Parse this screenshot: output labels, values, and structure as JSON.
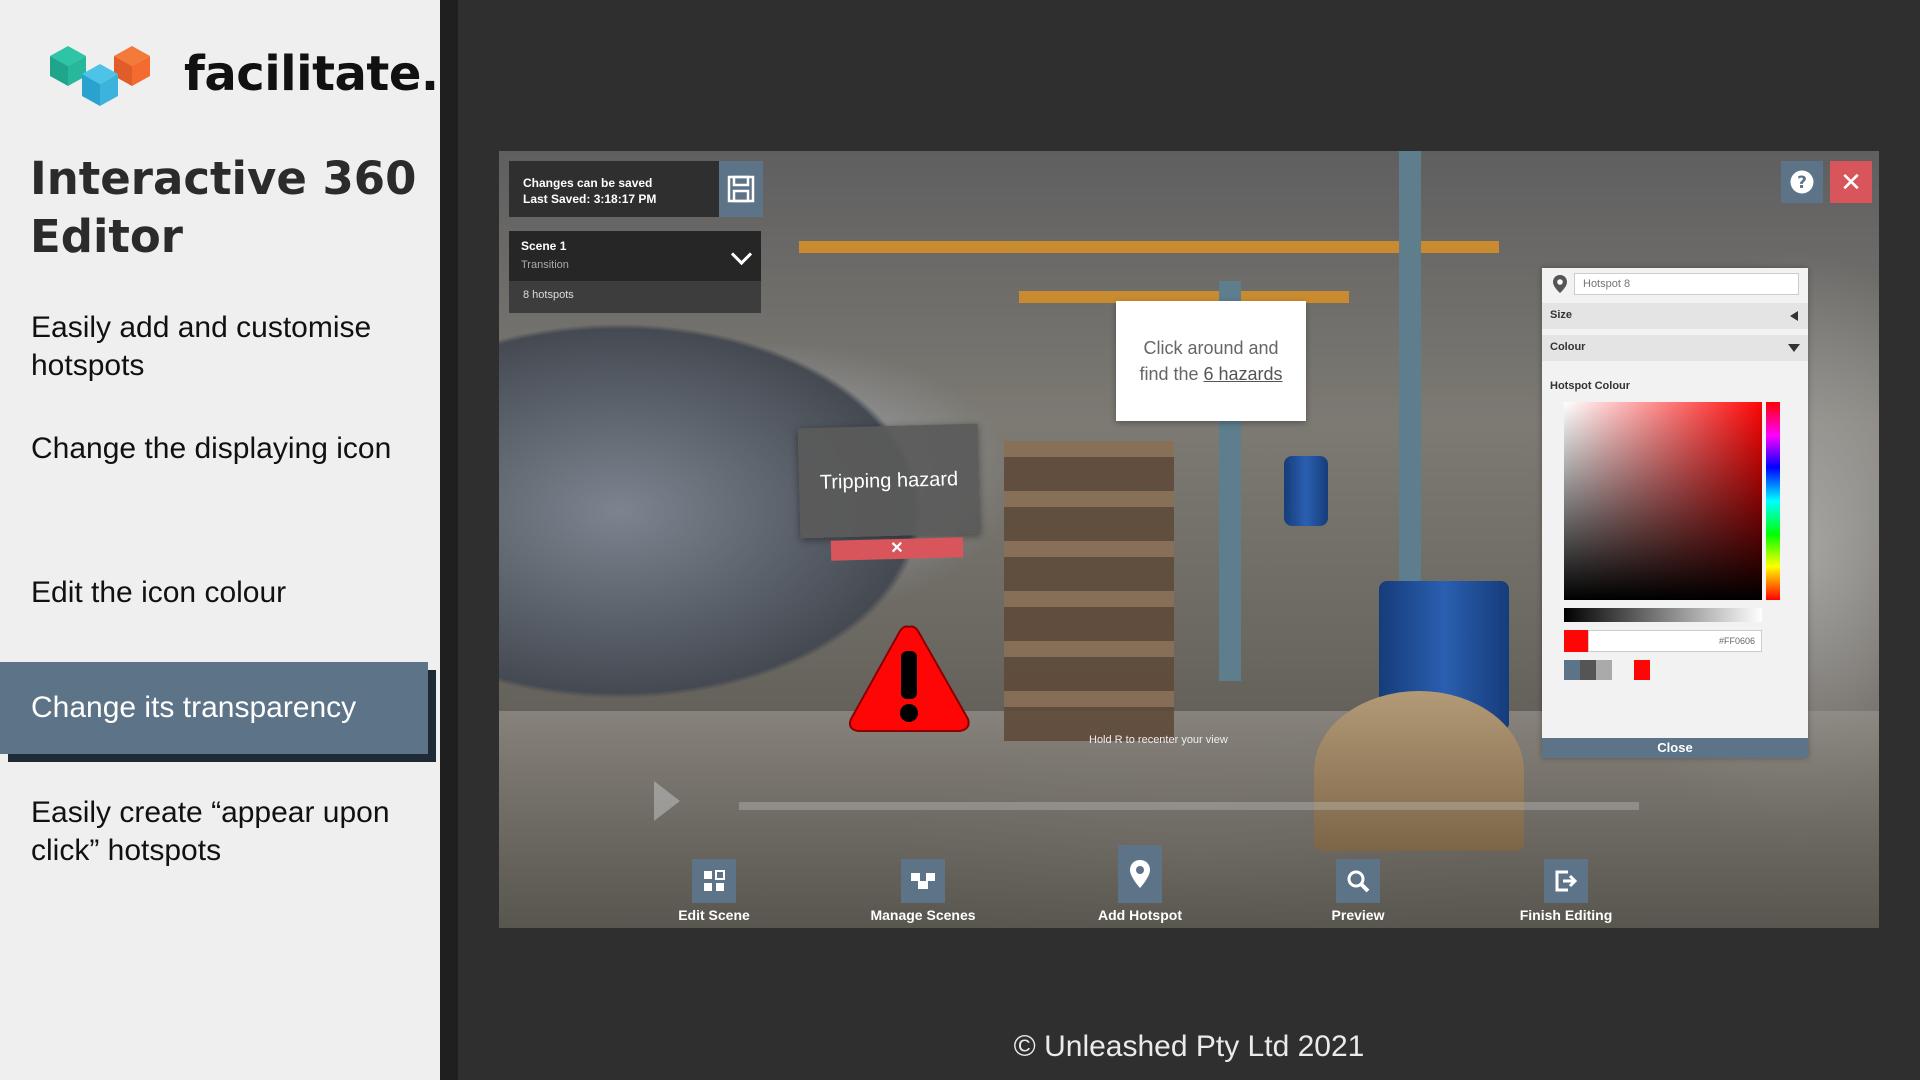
{
  "brand": {
    "name": "facilitate.",
    "logo": "facilitate-cube-logo"
  },
  "title": "Interactive 360 Editor",
  "features": [
    {
      "label": "Easily add and customise hotspots",
      "active": false
    },
    {
      "label": "Change the displaying icon",
      "active": false
    },
    {
      "label": "Edit the icon colour",
      "active": false
    },
    {
      "label": "Change its transparency",
      "active": true
    },
    {
      "label": "Easily create “appear upon click” hotspots",
      "active": false
    }
  ],
  "footer": "© Unleashed Pty Ltd 2021",
  "editor": {
    "status_line1": "Changes can be saved",
    "status_line2": "Last Saved: 3:18:17 PM",
    "scene_name": "Scene 1",
    "scene_type": "Transition",
    "hotspot_count": "8 hotspots",
    "hint_line1": "Click around and",
    "hint_line2_prefix": "find the ",
    "hint_line2_link": "6 hazards",
    "tooltip_text": "Tripping hazard",
    "tooltip_close": "✕",
    "recenter_hint": "Hold R to recenter your view",
    "close_symbol": "✕",
    "props": {
      "name_placeholder": "Hotspot 8",
      "size_label": "Size",
      "colour_label": "Colour",
      "hotspot_colour_label": "Hotspot Colour",
      "hex_value": "#FF0606",
      "close_label": "Close",
      "presets": [
        "#5d7387",
        "#555555",
        "#aaaaaa",
        "#ff0606"
      ]
    },
    "toolbar": [
      {
        "label": "Edit Scene",
        "icon": "grid-icon"
      },
      {
        "label": "Manage Scenes",
        "icon": "scenes-icon"
      },
      {
        "label": "Add Hotspot",
        "icon": "map-pin-icon"
      },
      {
        "label": "Preview",
        "icon": "magnifier-icon"
      },
      {
        "label": "Finish Editing",
        "icon": "exit-icon"
      }
    ]
  },
  "colors": {
    "accent": "#5d7387",
    "danger": "#d8555b",
    "hazard": "#ff0606"
  }
}
